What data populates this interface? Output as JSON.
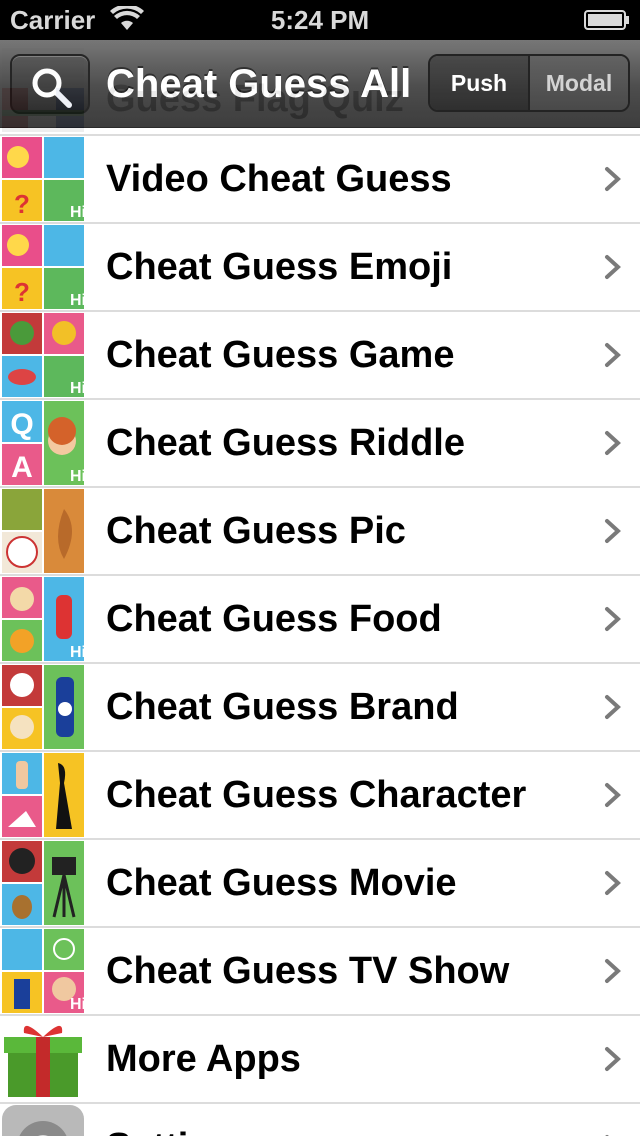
{
  "status_bar": {
    "carrier": "Carrier",
    "time": "5:24 PM"
  },
  "navbar": {
    "title": "Cheat Guess All",
    "partially_hidden_row": "Guess Flag Quiz",
    "segments": [
      "Push",
      "Modal"
    ],
    "selected_segment": "Push"
  },
  "list": {
    "items": [
      {
        "label": "Video Cheat Guess",
        "icon": "quad-emoji-icon"
      },
      {
        "label": "Cheat Guess Emoji",
        "icon": "quad-emoji-icon"
      },
      {
        "label": "Cheat Guess Game",
        "icon": "quad-game-icon"
      },
      {
        "label": "Cheat Guess Riddle",
        "icon": "quad-riddle-icon"
      },
      {
        "label": "Cheat Guess Pic",
        "icon": "quad-pic-icon"
      },
      {
        "label": "Cheat Guess Food",
        "icon": "quad-food-icon"
      },
      {
        "label": "Cheat Guess Brand",
        "icon": "quad-brand-icon"
      },
      {
        "label": "Cheat Guess Character",
        "icon": "quad-character-icon"
      },
      {
        "label": "Cheat Guess Movie",
        "icon": "quad-movie-icon"
      },
      {
        "label": "Cheat Guess TV Show",
        "icon": "quad-tv-icon"
      },
      {
        "label": "More Apps",
        "icon": "gift-icon"
      },
      {
        "label": "Settings",
        "icon": "gear-icon"
      }
    ]
  },
  "colors": {
    "navbar_dark": "#2d2d2d",
    "separator": "#dcdcdc",
    "chevron": "#7a7a7a"
  }
}
